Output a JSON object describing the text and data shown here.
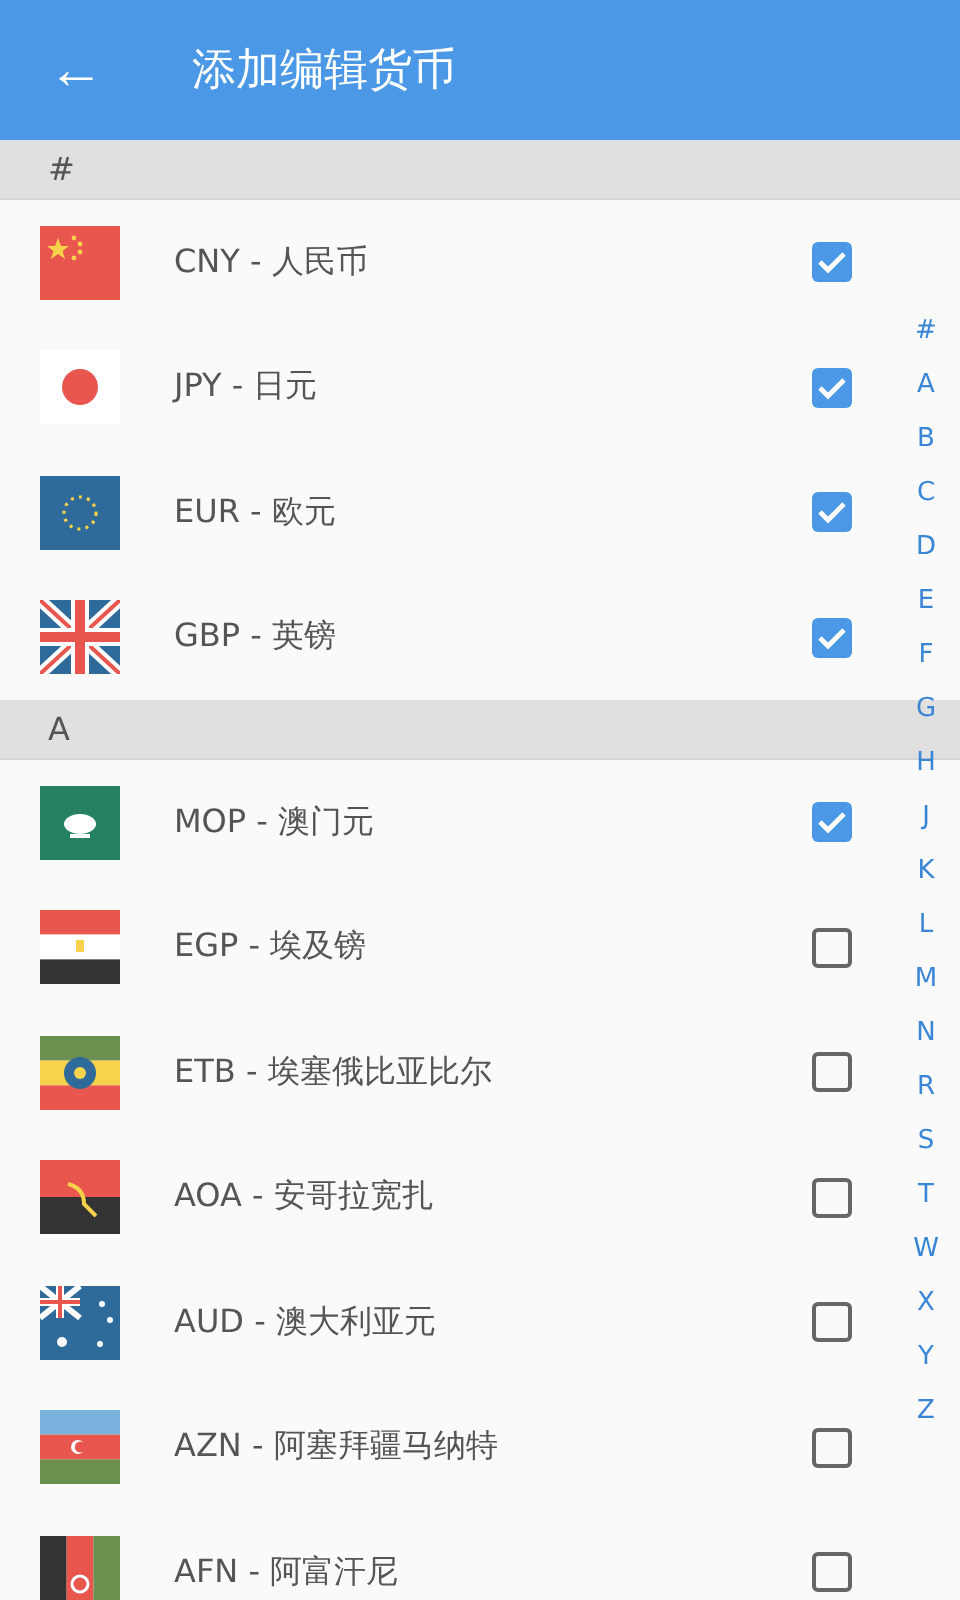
{
  "app_bar": {
    "back_icon": "←",
    "title": "添加编辑货币"
  },
  "sections": [
    {
      "header": "#",
      "items": [
        {
          "label": "CNY - 人民币",
          "checked": true
        },
        {
          "label": "JPY - 日元",
          "checked": true
        },
        {
          "label": "EUR - 欧元",
          "checked": true
        },
        {
          "label": "GBP - 英镑",
          "checked": true
        }
      ]
    },
    {
      "header": "A",
      "items": [
        {
          "label": "MOP - 澳门元",
          "checked": true
        },
        {
          "label": "EGP - 埃及镑",
          "checked": false
        },
        {
          "label": "ETB - 埃塞俄比亚比尔",
          "checked": false
        },
        {
          "label": "AOA - 安哥拉宽扎",
          "checked": false
        },
        {
          "label": "AUD - 澳大利亚元",
          "checked": false
        },
        {
          "label": "AZN - 阿塞拜疆马纳特",
          "checked": false
        },
        {
          "label": "AFN - 阿富汗尼",
          "checked": false
        }
      ]
    }
  ],
  "index_bar": [
    "#",
    "A",
    "B",
    "C",
    "D",
    "E",
    "F",
    "G",
    "H",
    "J",
    "K",
    "L",
    "M",
    "N",
    "R",
    "S",
    "T",
    "W",
    "X",
    "Y",
    "Z"
  ]
}
